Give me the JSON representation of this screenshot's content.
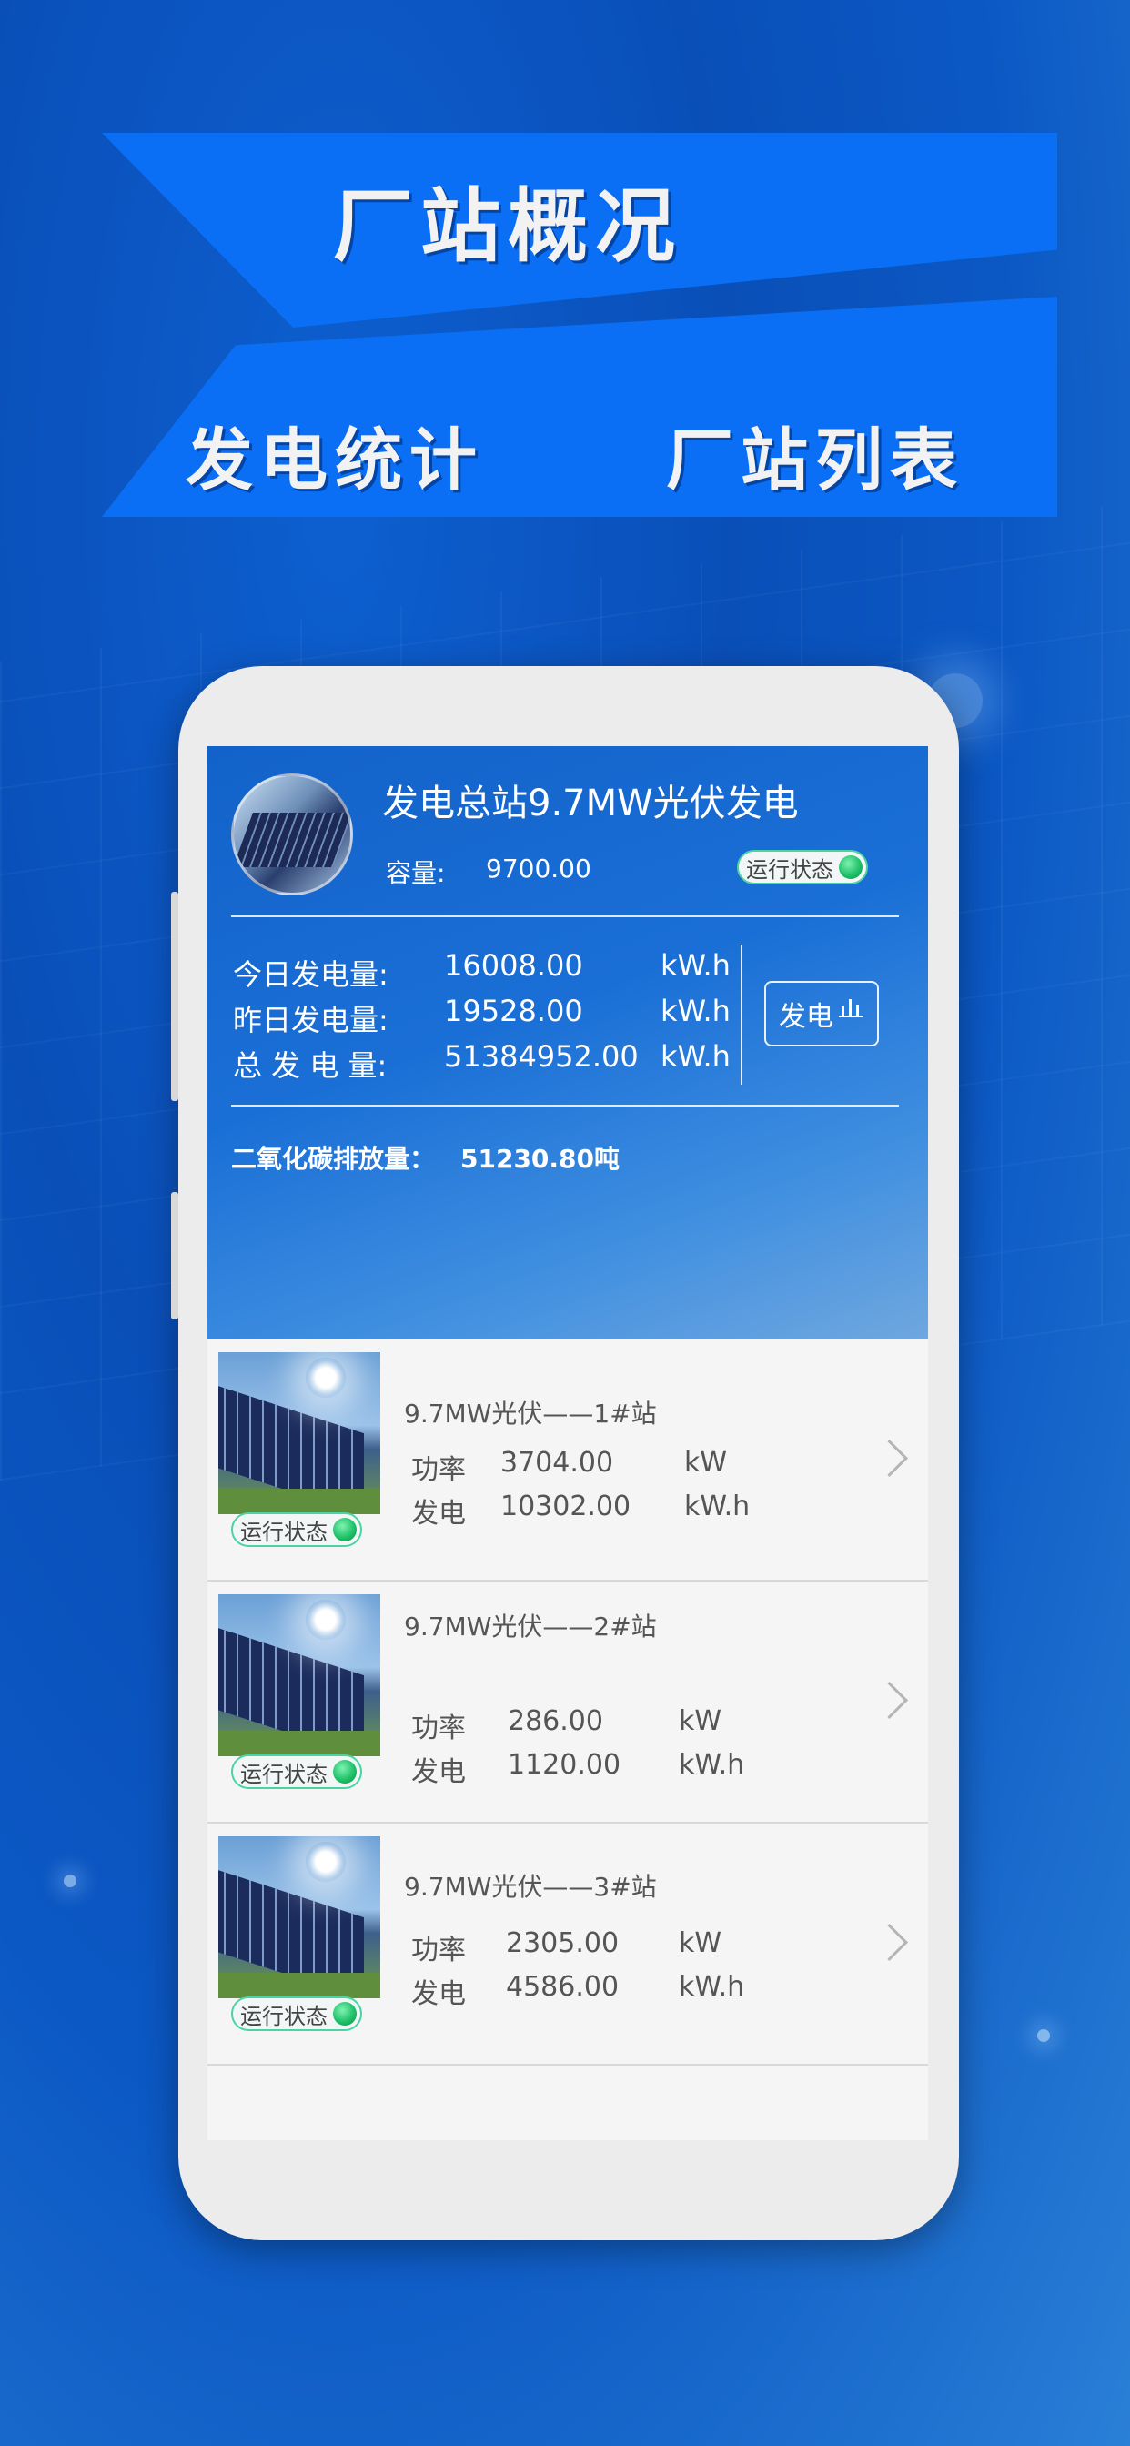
{
  "banner": {
    "title": "厂站概况",
    "left_tab": "发电统计",
    "right_tab": "厂站列表"
  },
  "station": {
    "name": "发电总站9.7MW光伏发电",
    "capacity_label": "容量:",
    "capacity_value": "9700.00",
    "status_label": "运行状态",
    "stats": [
      {
        "label": "今日发电量:",
        "value": "16008.00",
        "unit": "kW.h"
      },
      {
        "label": "昨日发电量:",
        "value": "19528.00",
        "unit": "kW.h"
      },
      {
        "label": "总 发 电 量:",
        "value": "51384952.00",
        "unit": "kW.h"
      }
    ],
    "gen_button": "发电",
    "co2_label": "二氧化碳排放量：",
    "co2_value": "51230.80吨"
  },
  "list": [
    {
      "title": "9.7MW光伏——1#站",
      "status": "运行状态",
      "power_label": "功率",
      "power_value": "3704.00",
      "power_unit": "kW",
      "gen_label": "发电",
      "gen_value": "10302.00",
      "gen_unit": "kW.h"
    },
    {
      "title": "9.7MW光伏——2#站",
      "status": "运行状态",
      "power_label": "功率",
      "power_value": "286.00",
      "power_unit": "kW",
      "gen_label": "发电",
      "gen_value": "1120.00",
      "gen_unit": "kW.h"
    },
    {
      "title": "9.7MW光伏——3#站",
      "status": "运行状态",
      "power_label": "功率",
      "power_value": "2305.00",
      "power_unit": "kW",
      "gen_label": "发电",
      "gen_value": "4586.00",
      "gen_unit": "kW.h"
    }
  ],
  "colors": {
    "banner": "#0b6ff5",
    "status_dot": "#20c26a",
    "status_border": "#4cd3a2"
  },
  "icons": [
    "bar-chart-icon",
    "chevron-right-icon",
    "status-dot-icon"
  ]
}
